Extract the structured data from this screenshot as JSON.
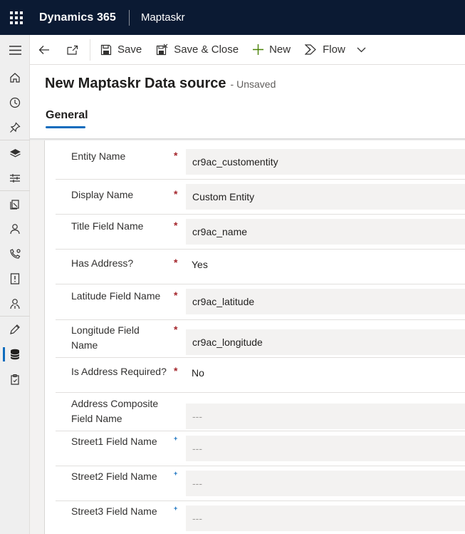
{
  "topbar": {
    "app_title": "Dynamics 365",
    "app_name": "Maptaskr"
  },
  "commandbar": {
    "save": "Save",
    "save_close": "Save & Close",
    "new": "New",
    "flow": "Flow"
  },
  "header": {
    "title": "New Maptaskr Data source",
    "status": "- Unsaved",
    "tab_general": "General"
  },
  "form": {
    "entity_name": {
      "label": "Entity Name",
      "value": "cr9ac_customentity",
      "required": "*"
    },
    "display_name": {
      "label": "Display Name",
      "value": "Custom Entity",
      "required": "*"
    },
    "title_field": {
      "label": "Title Field Name",
      "value": "cr9ac_name",
      "required": "*"
    },
    "has_address": {
      "label": "Has Address?",
      "value": "Yes",
      "required": "*"
    },
    "latitude": {
      "label": "Latitude Field Name",
      "value": "cr9ac_latitude",
      "required": "*"
    },
    "longitude": {
      "label": "Longitude Field Name",
      "value": "cr9ac_longitude",
      "required": "*"
    },
    "address_required": {
      "label": "Is Address Required?",
      "value": "No",
      "required": "*"
    },
    "address_composite": {
      "label": "Address Composite Field Name",
      "value": "---"
    },
    "street1": {
      "label": "Street1 Field Name",
      "value": "---",
      "recommended": "+"
    },
    "street2": {
      "label": "Street2 Field Name",
      "value": "---",
      "recommended": "+"
    },
    "street3": {
      "label": "Street3 Field Name",
      "value": "---",
      "recommended": "+"
    }
  },
  "colors": {
    "topbar_bg": "#0b1a33",
    "accent": "#0f6cbd",
    "required": "#a4262c",
    "field_bg": "#f3f2f1"
  },
  "icons": {
    "rail": [
      "hamburger-icon",
      "home-icon",
      "recent-icon",
      "pin-icon",
      "layers-icon",
      "settings-sliders-icon",
      "documents-icon",
      "person-icon",
      "phone-settings-icon",
      "alert-doc-icon",
      "person-pin-icon",
      "pencil-icon",
      "database-icon",
      "clipboard-icon"
    ]
  }
}
